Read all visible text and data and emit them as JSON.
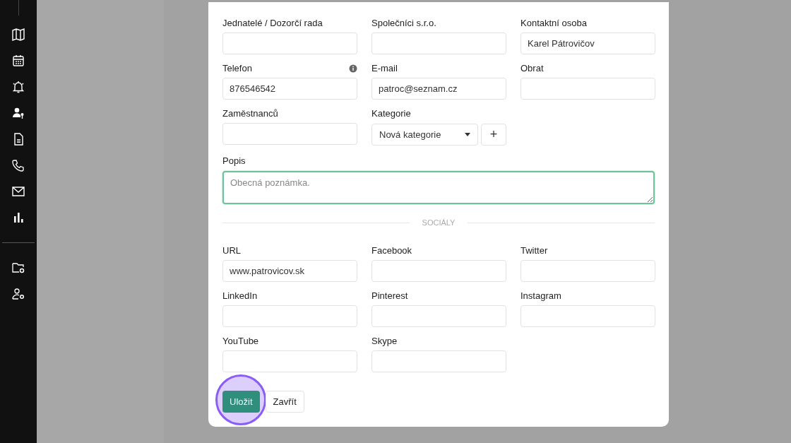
{
  "form": {
    "fields": [
      {
        "label": "Jednatelé / Dozorčí rada",
        "kind": "text"
      },
      {
        "label": "Společníci s.r.o.",
        "kind": "text"
      },
      {
        "label": "Kontaktní osoba",
        "kind": "text",
        "value": "Karel Pátrovičov"
      },
      {
        "label": "Telefon",
        "kind": "text",
        "value": "876546542",
        "info": true
      },
      {
        "label": "E-mail",
        "kind": "text",
        "value": "patroc@seznam.cz"
      },
      {
        "label": "Obrat",
        "kind": "text"
      },
      {
        "label": "Zaměstnanců",
        "kind": "text"
      },
      {
        "label": "Kategorie",
        "kind": "select",
        "value": "Nová kategorie",
        "add_button": "+"
      }
    ],
    "description": {
      "label": "Popis",
      "placeholder": "Obecná poznámka.",
      "focused": true
    },
    "section_divider": "SOCIÁLY",
    "social_fields": [
      {
        "label": "URL",
        "kind": "text",
        "value": "www.patrovicov.sk"
      },
      {
        "label": "Facebook",
        "kind": "text"
      },
      {
        "label": "Twitter",
        "kind": "text"
      },
      {
        "label": "LinkedIn",
        "kind": "text"
      },
      {
        "label": "Pinterest",
        "kind": "text"
      },
      {
        "label": "Instagram",
        "kind": "text"
      },
      {
        "label": "YouTube",
        "kind": "text"
      },
      {
        "label": "Skype",
        "kind": "text"
      }
    ],
    "buttons": [
      {
        "label": "Uložit",
        "kind": "primary",
        "highlighted": true
      },
      {
        "label": "Zavřít",
        "kind": "secondary",
        "highlighted": false
      }
    ]
  }
}
